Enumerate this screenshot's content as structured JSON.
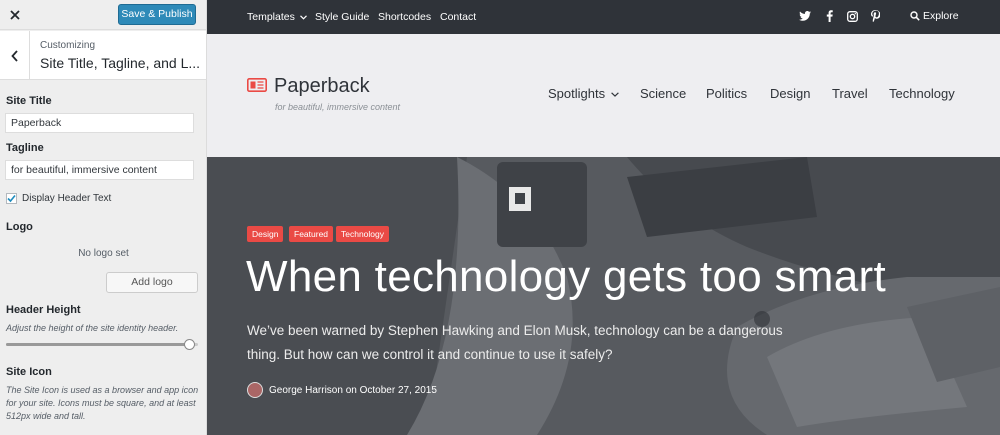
{
  "customizer": {
    "close_icon": "close-icon",
    "save_label": "Save & Publish",
    "back_icon": "chevron-left-icon",
    "breadcrumb_small": "Customizing",
    "section_title": "Site Title, Tagline, and L...",
    "site_title_label": "Site Title",
    "site_title_value": "Paperback",
    "tagline_label": "Tagline",
    "tagline_value": "for beautiful, immersive content",
    "display_header_text_label": "Display Header Text",
    "display_header_text_checked": true,
    "logo_label": "Logo",
    "no_logo_text": "No logo set",
    "add_logo_label": "Add logo",
    "header_height_label": "Header Height",
    "header_height_desc": "Adjust the height of the site identity header.",
    "header_height_value": 0.96,
    "site_icon_label": "Site Icon",
    "site_icon_desc": "The Site Icon is used as a browser and app icon for your site. Icons must be square, and at least 512px wide and tall.",
    "accent_color": "#2e8ab8"
  },
  "topbar": {
    "links": [
      "Templates",
      "Style Guide",
      "Shortcodes",
      "Contact"
    ],
    "social_icons": [
      "twitter-icon",
      "facebook-icon",
      "instagram-icon",
      "pinterest-icon"
    ],
    "explore_label": "Explore"
  },
  "site": {
    "title": "Paperback",
    "tagline": "for beautiful, immersive content",
    "logo_color": "#ea4a45",
    "nav": [
      "Spotlights",
      "Science",
      "Politics",
      "Design",
      "Travel",
      "Technology"
    ]
  },
  "hero": {
    "tags": [
      "Design",
      "Featured",
      "Technology"
    ],
    "tag_color": "#ea4a45",
    "title": "When technology gets too smart",
    "excerpt": "We’ve been warned by Stephen Hawking and Elon Musk, technology can be a dangerous thing. But how can we control it and continue to use it safely?",
    "byline": "George Harrison on October 27, 2015"
  }
}
